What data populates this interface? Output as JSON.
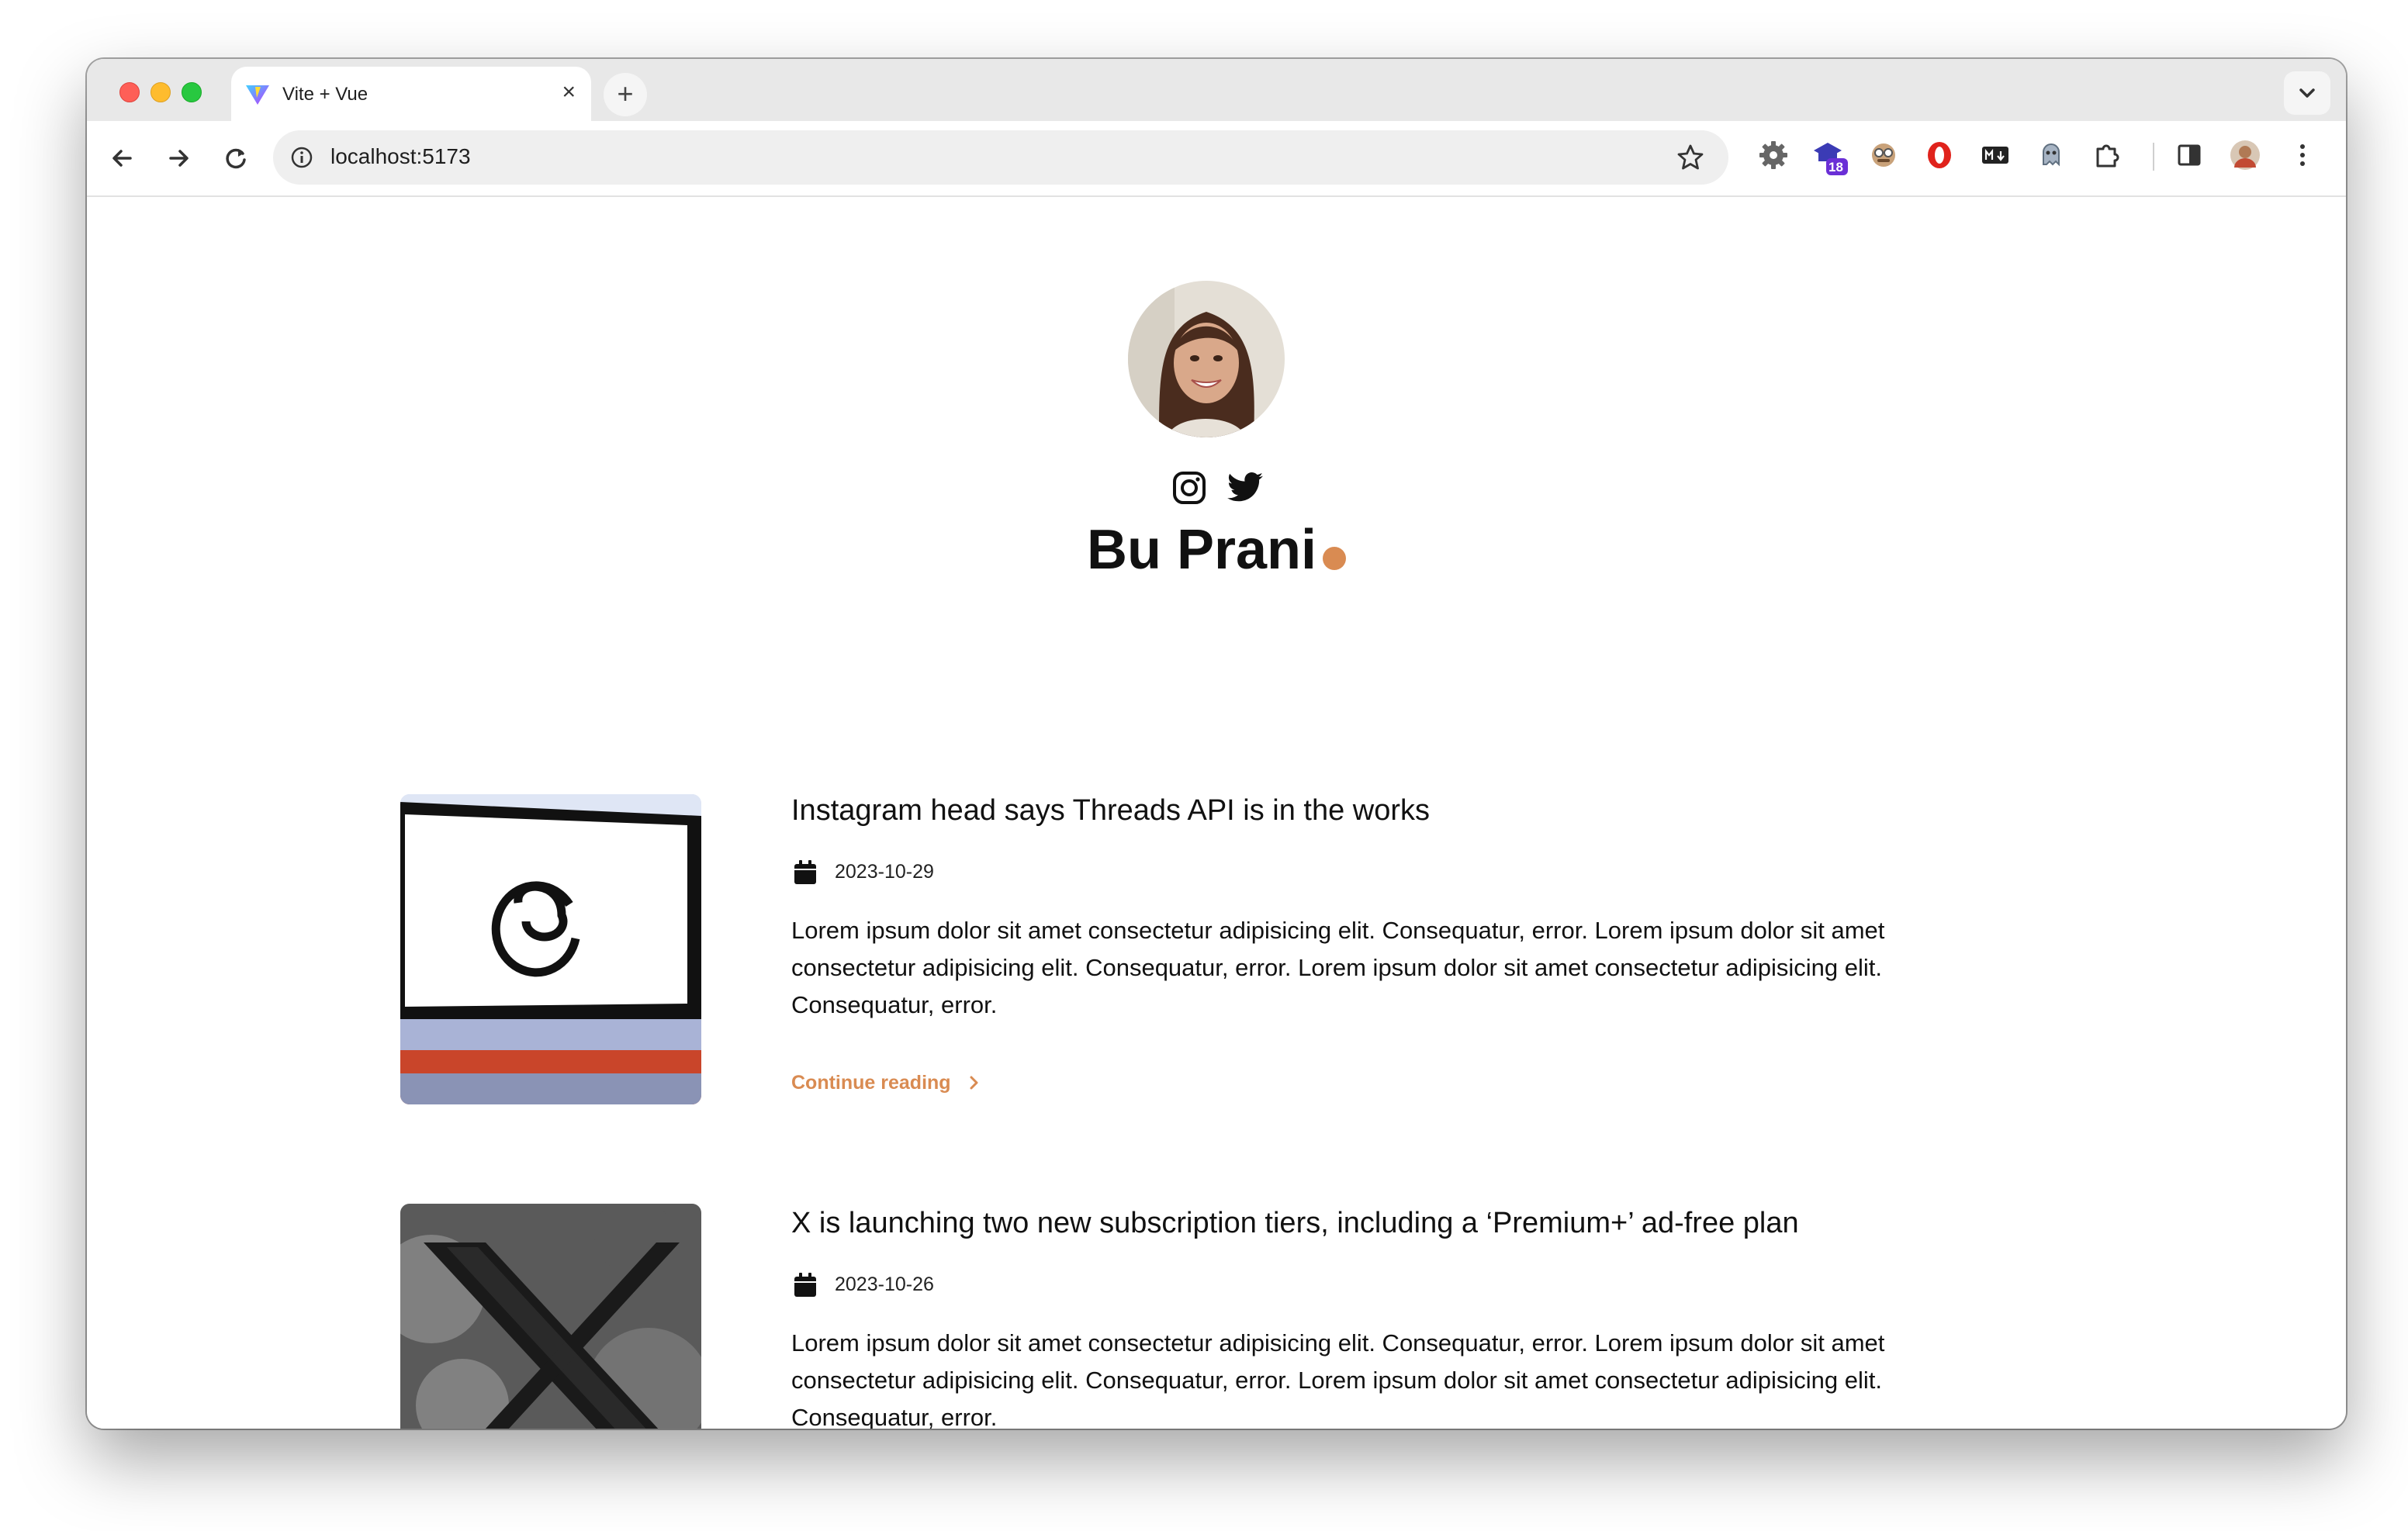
{
  "browser": {
    "tab_title": "Vite + Vue",
    "tab_close": "×",
    "new_tab": "+",
    "url": "localhost:5173",
    "extension_badge": "18"
  },
  "profile": {
    "name": "Bu Prani",
    "accent_color": "#d98b52",
    "social": [
      "instagram-icon",
      "twitter-icon"
    ]
  },
  "posts": [
    {
      "title": "Instagram head says Threads API is in the works",
      "date": "2023-10-29",
      "excerpt": "Lorem ipsum dolor sit amet consectetur adipisicing elit. Consequatur, error. Lorem ipsum dolor sit amet consectetur adipisicing elit. Consequatur, error. Lorem ipsum dolor sit amet consectetur adipisicing elit. Consequatur, error.",
      "more": "Continue reading"
    },
    {
      "title": "X is launching two new subscription tiers, including a ‘Premium+’ ad-free plan",
      "date": "2023-10-26",
      "excerpt": "Lorem ipsum dolor sit amet consectetur adipisicing elit. Consequatur, error. Lorem ipsum dolor sit amet consectetur adipisicing elit. Consequatur, error. Lorem ipsum dolor sit amet consectetur adipisicing elit. Consequatur, error."
    }
  ]
}
